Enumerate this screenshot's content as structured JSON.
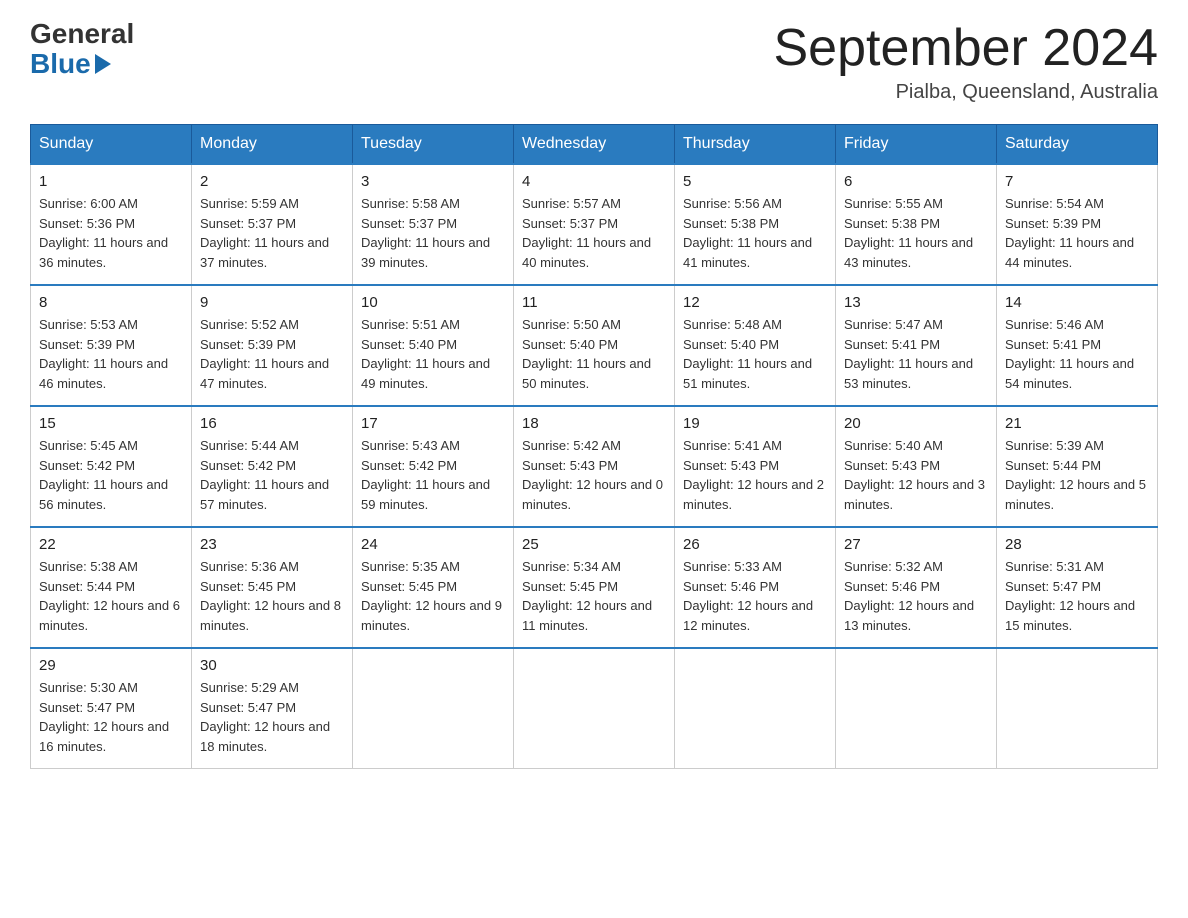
{
  "logo": {
    "general": "General",
    "blue": "Blue"
  },
  "header": {
    "month_year": "September 2024",
    "location": "Pialba, Queensland, Australia"
  },
  "days_of_week": [
    "Sunday",
    "Monday",
    "Tuesday",
    "Wednesday",
    "Thursday",
    "Friday",
    "Saturday"
  ],
  "weeks": [
    [
      {
        "day": "1",
        "sunrise": "6:00 AM",
        "sunset": "5:36 PM",
        "daylight": "11 hours and 36 minutes."
      },
      {
        "day": "2",
        "sunrise": "5:59 AM",
        "sunset": "5:37 PM",
        "daylight": "11 hours and 37 minutes."
      },
      {
        "day": "3",
        "sunrise": "5:58 AM",
        "sunset": "5:37 PM",
        "daylight": "11 hours and 39 minutes."
      },
      {
        "day": "4",
        "sunrise": "5:57 AM",
        "sunset": "5:37 PM",
        "daylight": "11 hours and 40 minutes."
      },
      {
        "day": "5",
        "sunrise": "5:56 AM",
        "sunset": "5:38 PM",
        "daylight": "11 hours and 41 minutes."
      },
      {
        "day": "6",
        "sunrise": "5:55 AM",
        "sunset": "5:38 PM",
        "daylight": "11 hours and 43 minutes."
      },
      {
        "day": "7",
        "sunrise": "5:54 AM",
        "sunset": "5:39 PM",
        "daylight": "11 hours and 44 minutes."
      }
    ],
    [
      {
        "day": "8",
        "sunrise": "5:53 AM",
        "sunset": "5:39 PM",
        "daylight": "11 hours and 46 minutes."
      },
      {
        "day": "9",
        "sunrise": "5:52 AM",
        "sunset": "5:39 PM",
        "daylight": "11 hours and 47 minutes."
      },
      {
        "day": "10",
        "sunrise": "5:51 AM",
        "sunset": "5:40 PM",
        "daylight": "11 hours and 49 minutes."
      },
      {
        "day": "11",
        "sunrise": "5:50 AM",
        "sunset": "5:40 PM",
        "daylight": "11 hours and 50 minutes."
      },
      {
        "day": "12",
        "sunrise": "5:48 AM",
        "sunset": "5:40 PM",
        "daylight": "11 hours and 51 minutes."
      },
      {
        "day": "13",
        "sunrise": "5:47 AM",
        "sunset": "5:41 PM",
        "daylight": "11 hours and 53 minutes."
      },
      {
        "day": "14",
        "sunrise": "5:46 AM",
        "sunset": "5:41 PM",
        "daylight": "11 hours and 54 minutes."
      }
    ],
    [
      {
        "day": "15",
        "sunrise": "5:45 AM",
        "sunset": "5:42 PM",
        "daylight": "11 hours and 56 minutes."
      },
      {
        "day": "16",
        "sunrise": "5:44 AM",
        "sunset": "5:42 PM",
        "daylight": "11 hours and 57 minutes."
      },
      {
        "day": "17",
        "sunrise": "5:43 AM",
        "sunset": "5:42 PM",
        "daylight": "11 hours and 59 minutes."
      },
      {
        "day": "18",
        "sunrise": "5:42 AM",
        "sunset": "5:43 PM",
        "daylight": "12 hours and 0 minutes."
      },
      {
        "day": "19",
        "sunrise": "5:41 AM",
        "sunset": "5:43 PM",
        "daylight": "12 hours and 2 minutes."
      },
      {
        "day": "20",
        "sunrise": "5:40 AM",
        "sunset": "5:43 PM",
        "daylight": "12 hours and 3 minutes."
      },
      {
        "day": "21",
        "sunrise": "5:39 AM",
        "sunset": "5:44 PM",
        "daylight": "12 hours and 5 minutes."
      }
    ],
    [
      {
        "day": "22",
        "sunrise": "5:38 AM",
        "sunset": "5:44 PM",
        "daylight": "12 hours and 6 minutes."
      },
      {
        "day": "23",
        "sunrise": "5:36 AM",
        "sunset": "5:45 PM",
        "daylight": "12 hours and 8 minutes."
      },
      {
        "day": "24",
        "sunrise": "5:35 AM",
        "sunset": "5:45 PM",
        "daylight": "12 hours and 9 minutes."
      },
      {
        "day": "25",
        "sunrise": "5:34 AM",
        "sunset": "5:45 PM",
        "daylight": "12 hours and 11 minutes."
      },
      {
        "day": "26",
        "sunrise": "5:33 AM",
        "sunset": "5:46 PM",
        "daylight": "12 hours and 12 minutes."
      },
      {
        "day": "27",
        "sunrise": "5:32 AM",
        "sunset": "5:46 PM",
        "daylight": "12 hours and 13 minutes."
      },
      {
        "day": "28",
        "sunrise": "5:31 AM",
        "sunset": "5:47 PM",
        "daylight": "12 hours and 15 minutes."
      }
    ],
    [
      {
        "day": "29",
        "sunrise": "5:30 AM",
        "sunset": "5:47 PM",
        "daylight": "12 hours and 16 minutes."
      },
      {
        "day": "30",
        "sunrise": "5:29 AM",
        "sunset": "5:47 PM",
        "daylight": "12 hours and 18 minutes."
      },
      null,
      null,
      null,
      null,
      null
    ]
  ],
  "labels": {
    "sunrise": "Sunrise:",
    "sunset": "Sunset:",
    "daylight": "Daylight:"
  }
}
